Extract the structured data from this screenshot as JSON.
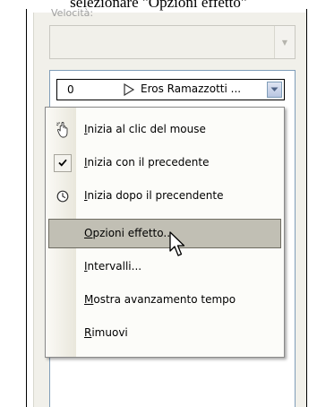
{
  "caption": "selezionare \"Opzioni effetto\"",
  "speed": {
    "label": "Velocità:",
    "value": ""
  },
  "animation_list": {
    "row": {
      "number": "0",
      "label": "Eros Ramazzotti ..."
    }
  },
  "context_menu": {
    "items": [
      {
        "label": "Inizia al clic del mouse",
        "icon": "mouse-click-icon"
      },
      {
        "label": "Inizia con il precedente",
        "icon": "check-icon"
      },
      {
        "label": "Inizia dopo il precendente",
        "icon": "clock-icon"
      },
      {
        "label": "Opzioni effetto...",
        "icon": "",
        "highlighted": true
      },
      {
        "label": "Intervalli...",
        "icon": ""
      },
      {
        "label": "Mostra avanzamento tempo",
        "icon": ""
      },
      {
        "label": "Rimuovi",
        "icon": ""
      }
    ]
  }
}
